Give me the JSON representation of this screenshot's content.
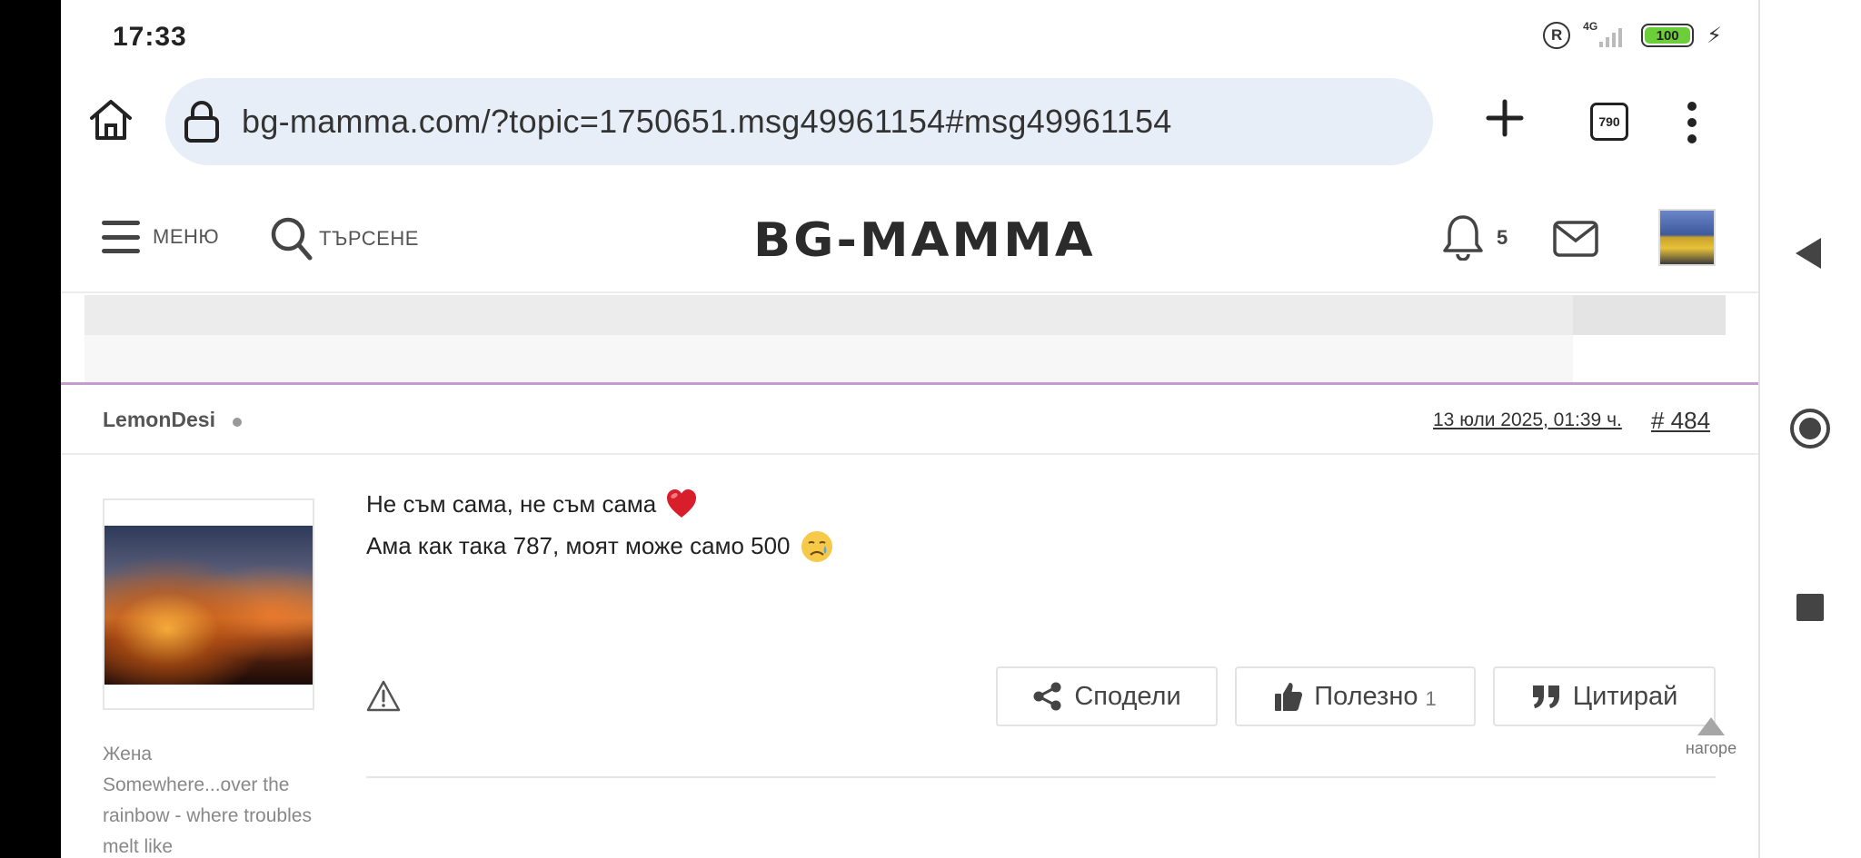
{
  "status_bar": {
    "time": "17:33",
    "registered_mark": "R",
    "network": "4G",
    "battery": "100"
  },
  "browser": {
    "url": "bg-mamma.com/?topic=1750651.msg49961154#msg49961154",
    "tab_count": "790"
  },
  "site_header": {
    "menu_label": "МЕНЮ",
    "search_label": "ТЪРСЕНЕ",
    "logo": "BG-MAMMA",
    "notification_count": "5"
  },
  "post": {
    "author": "LemonDesi",
    "date": "13 юли 2025, 01:39 ч.",
    "number": "# 484",
    "lines": [
      "Не съм сама, не съм сама",
      "Ама как така 787, моят може само 500"
    ],
    "user_title": "Жена\nSomewhere...over the rainbow - where troubles melt like",
    "actions": {
      "share": "Сподели",
      "useful": "Полезно",
      "useful_count": "1",
      "quote": "Цитирай"
    }
  },
  "scroll_top_label": "нагоре",
  "colors": {
    "post_accent": "#c49ccd",
    "url_bar_bg": "#e8eef8",
    "battery": "#6ccf3a"
  }
}
